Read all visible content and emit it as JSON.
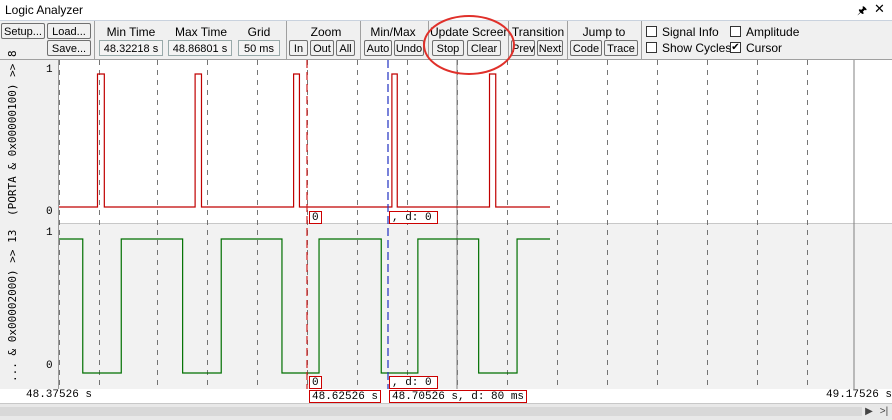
{
  "window": {
    "title": "Logic Analyzer",
    "pin_icon": "pin-icon",
    "close_icon": "close-icon"
  },
  "toolbar": {
    "setup": "Setup...",
    "load": "Load...",
    "save": "Save...",
    "min_time_label": "Min Time",
    "min_time_value": "48.32218 s",
    "max_time_label": "Max Time",
    "max_time_value": "48.86801 s",
    "grid_label": "Grid",
    "grid_value": "50 ms",
    "zoom_label": "Zoom",
    "zoom_in": "In",
    "zoom_out": "Out",
    "zoom_all": "All",
    "minmax_label": "Min/Max",
    "auto": "Auto",
    "undo": "Undo",
    "update_label": "Update Screen",
    "stop": "Stop",
    "clear": "Clear",
    "transition_label": "Transition",
    "prev": "Prev",
    "next": "Next",
    "jump_label": "Jump to",
    "code": "Code",
    "trace": "Trace",
    "signal_info": "Signal Info",
    "signal_info_checked": false,
    "amplitude": "Amplitude",
    "amplitude_checked": false,
    "show_cycles": "Show Cycles",
    "show_cycles_checked": false,
    "cursor": "Cursor",
    "cursor_checked": true
  },
  "signals": [
    {
      "name": "(PORTA & 0x00000100) >> 8",
      "high": "1",
      "low": "0",
      "color": "#c00000",
      "waveform": [
        [
          0,
          0
        ],
        [
          0.0784,
          1
        ],
        [
          0.0923,
          0
        ],
        [
          0.2772,
          1
        ],
        [
          0.2902,
          0
        ],
        [
          0.4778,
          1
        ],
        [
          0.4897,
          0
        ],
        [
          0.678,
          1
        ],
        [
          0.6889,
          0
        ],
        [
          0.8768,
          1
        ],
        [
          0.8895,
          0
        ],
        [
          1.0,
          0
        ]
      ]
    },
    {
      "name": "... & 0x00002000) >> 13",
      "high": "1",
      "low": "0",
      "color": "#007000",
      "waveform": [
        [
          0,
          1
        ],
        [
          0.0484,
          0
        ],
        [
          0.1268,
          1
        ],
        [
          0.2518,
          0
        ],
        [
          0.3304,
          1
        ],
        [
          0.4541,
          0
        ],
        [
          0.5296,
          1
        ],
        [
          0.6563,
          0
        ],
        [
          0.7309,
          1
        ],
        [
          0.8547,
          0
        ],
        [
          0.9329,
          1
        ],
        [
          1.0,
          1
        ]
      ]
    }
  ],
  "cursor_tags": {
    "sig1_left": "0",
    "sig1_right": ",  d: 0",
    "sig2_left": "0",
    "sig2_right": ",  d: 0"
  },
  "timebar": {
    "start": "48.37526  s",
    "end": "49.17526  s",
    "cursor1": "48.62526  s",
    "cursor2": "48.70526  s,  d: 80  ms"
  },
  "scrollbar": {
    "end_glyph": ">|"
  }
}
